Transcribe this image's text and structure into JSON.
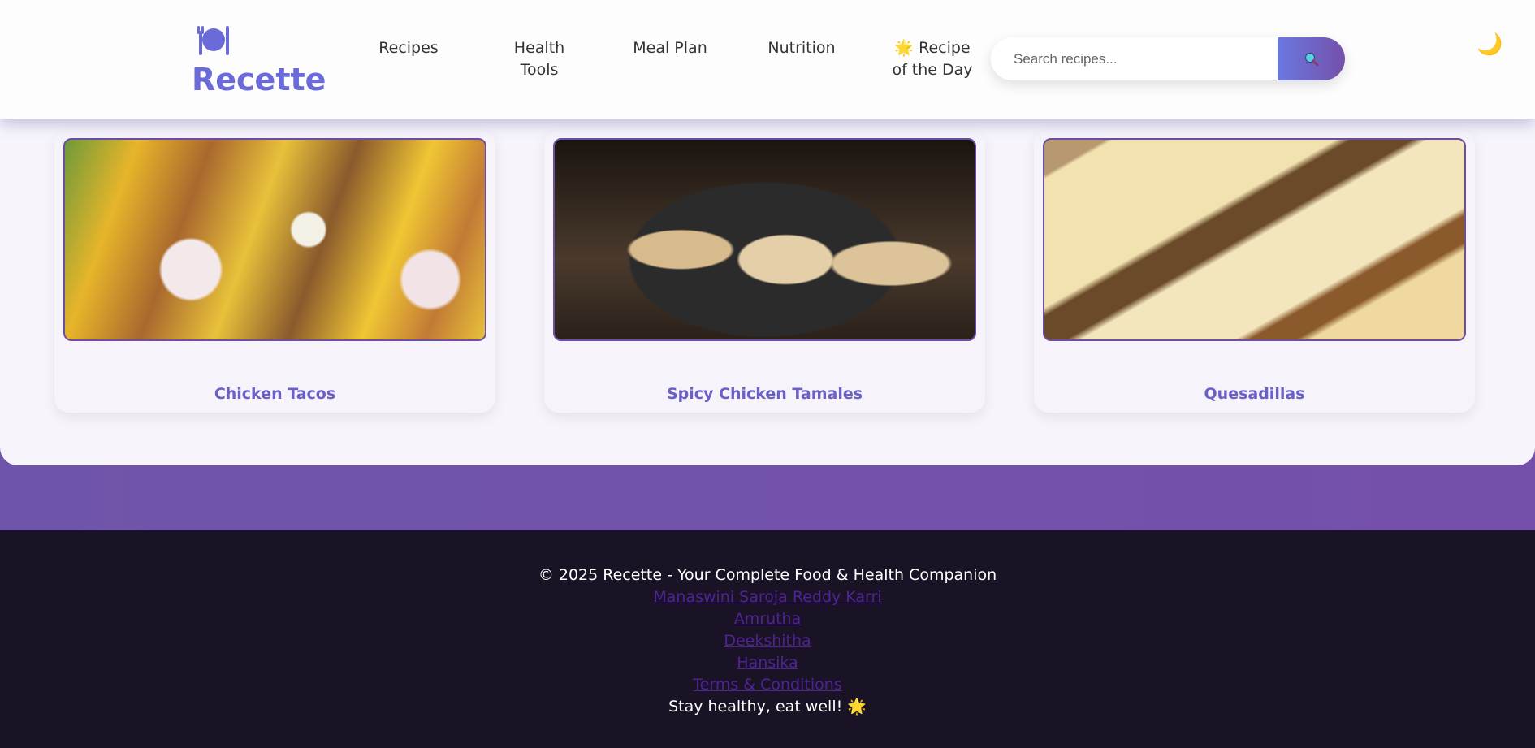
{
  "brand": {
    "name": "Recette",
    "icon": "plate-utensils-icon",
    "color": "#6a6bd8"
  },
  "nav": [
    {
      "label": "Recipes"
    },
    {
      "label": "Health Tools"
    },
    {
      "label": "Meal Plan"
    },
    {
      "label": "Nutrition"
    },
    {
      "label": "Recipe of the Day",
      "icon": "star-emoji"
    }
  ],
  "search": {
    "placeholder": "Search recipes...",
    "button_icon": "magnifier-icon"
  },
  "theme_toggle": {
    "icon": "moon-icon",
    "glyph": "🌙"
  },
  "recipes": [
    {
      "title": "Chicken Tacos"
    },
    {
      "title": "Spicy Chicken Tamales"
    },
    {
      "title": "Quesadillas"
    }
  ],
  "footer": {
    "copyright": "© 2025 Recette - Your Complete Food & Health Companion",
    "links": [
      "Manaswini Saroja Reddy Karri",
      "Amrutha",
      "Deekshitha",
      "Hansika",
      "Terms & Conditions"
    ],
    "tagline": "Stay healthy, eat well! 🌟"
  },
  "colors": {
    "accent": "#6a6bd8",
    "purple": "#7450aa",
    "footer_bg": "#1a1325",
    "link": "#4f2396"
  }
}
